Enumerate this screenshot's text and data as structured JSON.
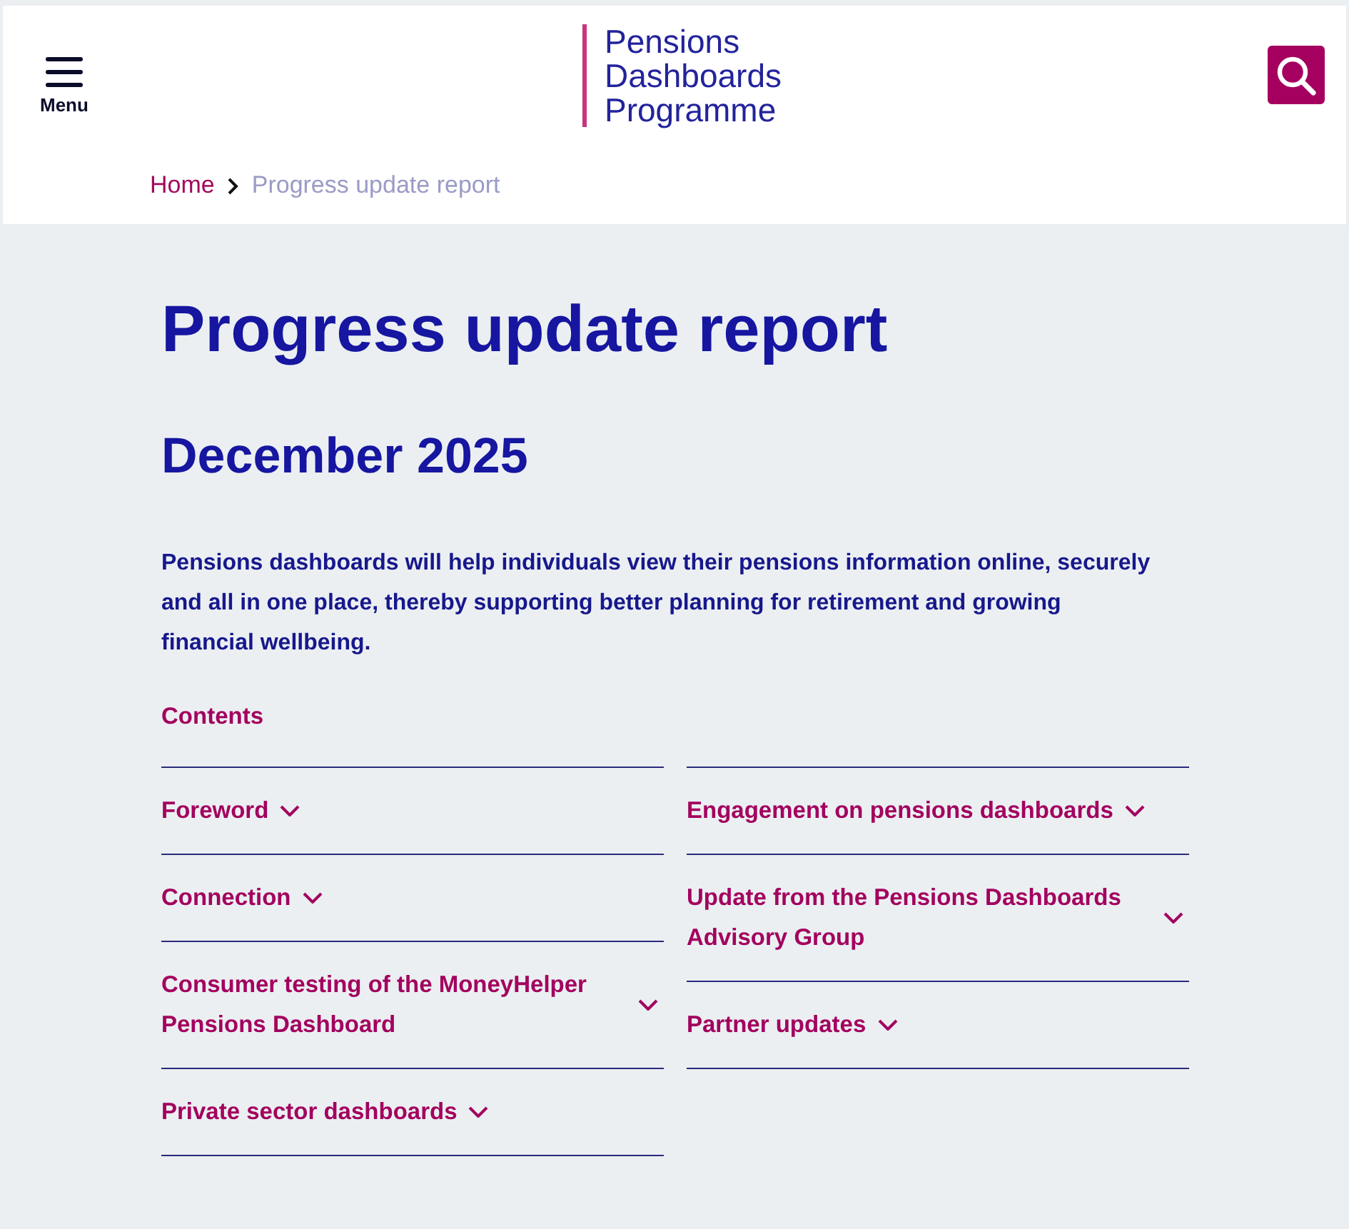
{
  "header": {
    "menu_button": {
      "label": "Menu"
    },
    "logo": {
      "lines": [
        "Pensions",
        "Dashboards",
        "Programme"
      ]
    },
    "breadcrumb": [
      {
        "kind": "link",
        "label": "Home"
      },
      {
        "kind": "current",
        "label": "Progress update report"
      }
    ]
  },
  "page": {
    "title": "Progress update report",
    "subtitle": "December 2025",
    "summary": "Pensions dashboards will help individuals view their pensions information online, securely and all in one place, thereby supporting better planning for retirement and growing financial wellbeing."
  },
  "contents": {
    "title": "Contents",
    "columns": [
      {
        "items": [
          {
            "label": "Foreword",
            "expanded": false
          },
          {
            "label": "Connection",
            "expanded": false
          },
          {
            "label": "Consumer testing of the MoneyHelper Pensions Dashboard",
            "expanded": false
          },
          {
            "label": "Private sector dashboards",
            "expanded": false
          }
        ]
      },
      {
        "items": [
          {
            "label": "Engagement on pensions dashboards",
            "expanded": false
          },
          {
            "label": "Update from the Pensions Dashboards Advisory Group",
            "expanded": false
          },
          {
            "label": "Partner updates",
            "expanded": false
          }
        ]
      }
    ]
  }
}
